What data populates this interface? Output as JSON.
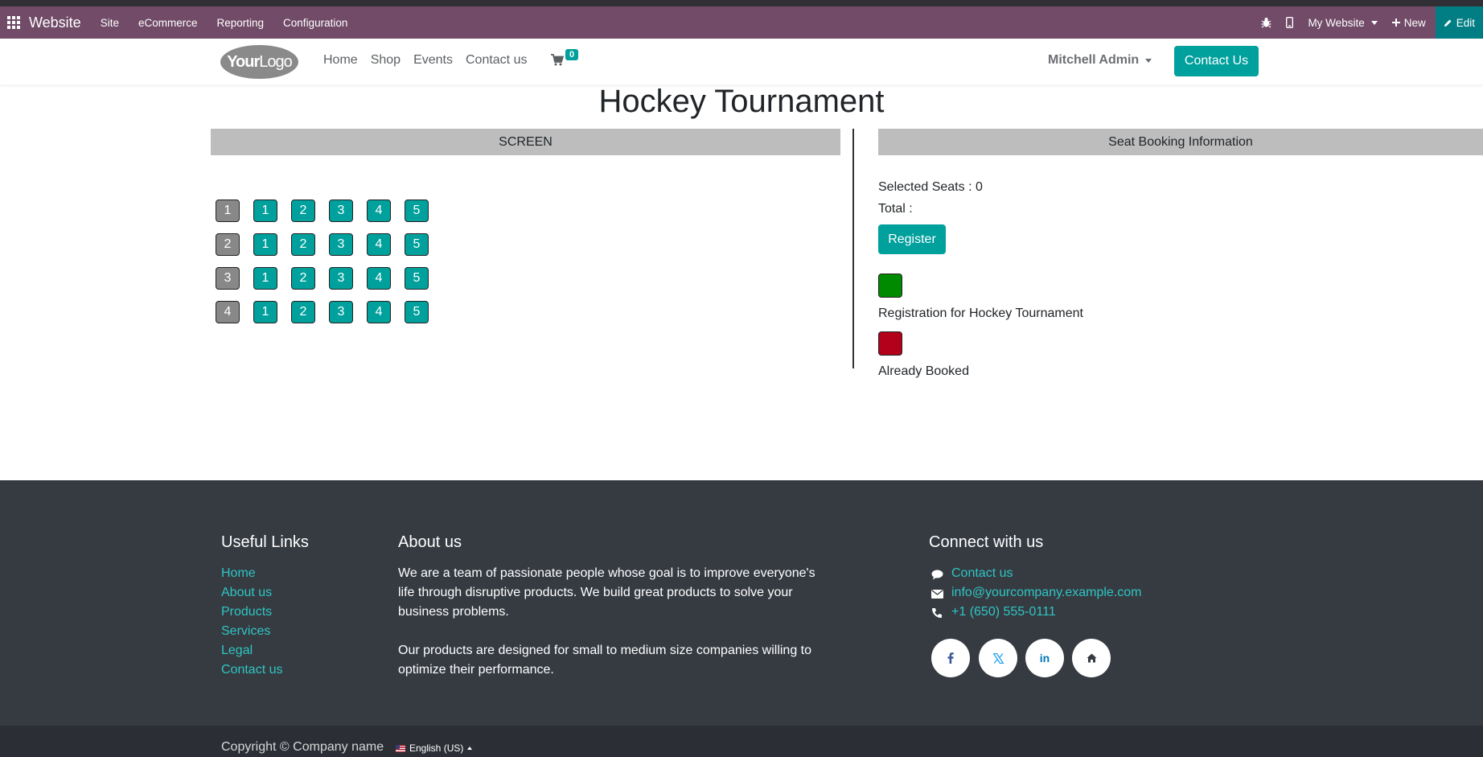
{
  "adminbar": {
    "brand": "Website",
    "menus": [
      "Site",
      "eCommerce",
      "Reporting",
      "Configuration"
    ],
    "website_selector": "My Website",
    "new_label": "New",
    "edit_label": "Edit"
  },
  "header": {
    "logo_bold": "Your",
    "logo_rest": "Logo",
    "nav": [
      "Home",
      "Shop",
      "Events",
      "Contact us"
    ],
    "cart_count": "0",
    "user": "Mitchell Admin",
    "contact_button": "Contact Us"
  },
  "main": {
    "title": "Hockey Tournament",
    "screen_label": "SCREEN",
    "booking_header": "Seat Booking Information",
    "rows": [
      {
        "label": "1",
        "seats": [
          "1",
          "2",
          "3",
          "4",
          "5"
        ]
      },
      {
        "label": "2",
        "seats": [
          "1",
          "2",
          "3",
          "4",
          "5"
        ]
      },
      {
        "label": "3",
        "seats": [
          "1",
          "2",
          "3",
          "4",
          "5"
        ]
      },
      {
        "label": "4",
        "seats": [
          "1",
          "2",
          "3",
          "4",
          "5"
        ]
      }
    ],
    "selected_seats": "Selected Seats : 0",
    "total": "Total :",
    "register_label": "Register",
    "legend": [
      {
        "label": "Registration for Hockey Tournament",
        "color": "#008a00"
      },
      {
        "label": "Already Booked",
        "color": "#b3001b"
      }
    ],
    "colors": {
      "accent": "#00a09d",
      "row_label": "#888888"
    }
  },
  "footer": {
    "useful_links_title": "Useful Links",
    "useful_links": [
      "Home",
      "About us",
      "Products",
      "Services",
      "Legal",
      "Contact us"
    ],
    "about_title": "About us",
    "about_p1_lines": [
      "We are a team of passionate people whose goal is to improve everyone's",
      "life through disruptive products. We build great products to solve your",
      "business problems."
    ],
    "about_p2_lines": [
      "Our products are designed for small to medium size companies willing to",
      "optimize their performance."
    ],
    "connect_title": "Connect with us",
    "connect_items": [
      {
        "icon": "comment-icon",
        "text": "Contact us"
      },
      {
        "icon": "envelope-icon",
        "text": "info@yourcompany.example.com"
      },
      {
        "icon": "phone-icon",
        "text": "+1 (650) 555-0111"
      }
    ],
    "social": [
      "facebook-icon",
      "x-twitter-icon",
      "linkedin-icon",
      "home-icon"
    ],
    "copyright": "Copyright © Company name",
    "language": "English (US)"
  }
}
